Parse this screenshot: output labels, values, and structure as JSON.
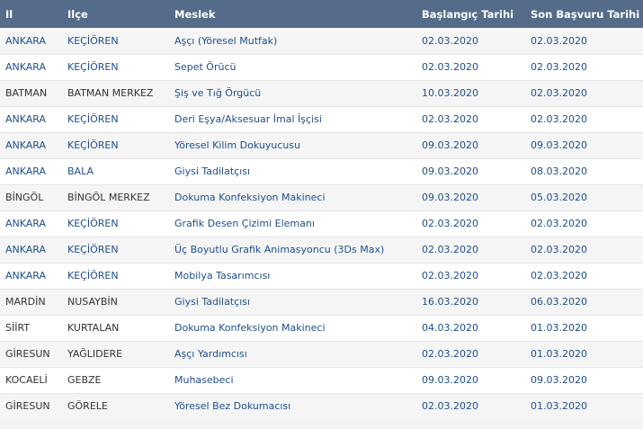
{
  "header": {
    "il": "Il",
    "ilce": "Ilçe",
    "meslek": "Meslek",
    "baslangic": "Başlangıç Tarihi",
    "son_basvuru": "Son Başvuru Tarihi"
  },
  "rows": [
    {
      "il": "ANKARA",
      "ilce": "KEÇİÖREN",
      "meslek": "Aşçı (Yöresel Mutfak)",
      "baslangic": "02.03.2020",
      "son": "02.03.2020"
    },
    {
      "il": "ANKARA",
      "ilce": "KEÇİÖREN",
      "meslek": "Sepet Örücü",
      "baslangic": "02.03.2020",
      "son": "02.03.2020"
    },
    {
      "il": "BATMAN",
      "ilce": "BATMAN MERKEZ",
      "meslek": "Şiş ve Tığ Örgücü",
      "baslangic": "10.03.2020",
      "son": "02.03.2020"
    },
    {
      "il": "ANKARA",
      "ilce": "KEÇİÖREN",
      "meslek": "Deri Eşya/Aksesuar İmal İşçisi",
      "baslangic": "02.03.2020",
      "son": "02.03.2020"
    },
    {
      "il": "ANKARA",
      "ilce": "KEÇİÖREN",
      "meslek": "Yöresel Kilim Dokuyucusu",
      "baslangic": "09.03.2020",
      "son": "09.03.2020"
    },
    {
      "il": "ANKARA",
      "ilce": "BALA",
      "meslek": "Giysi Tadilatçısı",
      "baslangic": "09.03.2020",
      "son": "08.03.2020"
    },
    {
      "il": "BİNGÖL",
      "ilce": "BİNGÖL MERKEZ",
      "meslek": "Dokuma Konfeksiyon Makineci",
      "baslangic": "09.03.2020",
      "son": "05.03.2020"
    },
    {
      "il": "ANKARA",
      "ilce": "KEÇİÖREN",
      "meslek": "Grafik Desen Çizimi Elemanı",
      "baslangic": "02.03.2020",
      "son": "02.03.2020"
    },
    {
      "il": "ANKARA",
      "ilce": "KEÇİÖREN",
      "meslek": "Üç Boyutlu Grafik Animasyoncu (3Ds Max)",
      "baslangic": "02.03.2020",
      "son": "02.03.2020"
    },
    {
      "il": "ANKARA",
      "ilce": "KEÇİÖREN",
      "meslek": "Mobilya Tasarımcısı",
      "baslangic": "02.03.2020",
      "son": "02.03.2020"
    },
    {
      "il": "MARDİN",
      "ilce": "NUSAYBİN",
      "meslek": "Giysi Tadilatçısı",
      "baslangic": "16.03.2020",
      "son": "06.03.2020"
    },
    {
      "il": "SİİRT",
      "ilce": "KURTALAN",
      "meslek": "Dokuma Konfeksiyon Makineci",
      "baslangic": "04.03.2020",
      "son": "01.03.2020"
    },
    {
      "il": "GİRESUN",
      "ilce": "YAĞLIDERE",
      "meslek": "Aşçı Yardımcısı",
      "baslangic": "02.03.2020",
      "son": "01.03.2020"
    },
    {
      "il": "KOCAELİ",
      "ilce": "GEBZE",
      "meslek": "Muhasebeci",
      "baslangic": "09.03.2020",
      "son": "09.03.2020"
    },
    {
      "il": "GİRESUN",
      "ilce": "GÖRELE",
      "meslek": "Yöresel Bez Dokumacısı",
      "baslangic": "02.03.2020",
      "son": "01.03.2020"
    }
  ]
}
